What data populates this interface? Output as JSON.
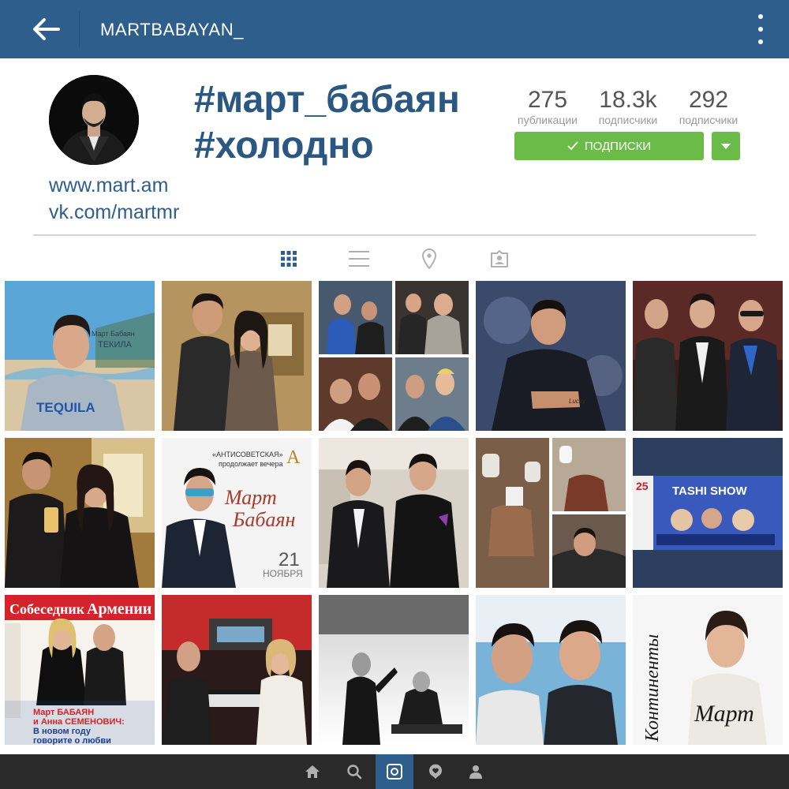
{
  "header": {
    "title": "MARTBABAYAN_",
    "back_icon": "arrow-left-icon",
    "menu_icon": "more-vertical-icon"
  },
  "profile": {
    "hashtags": [
      "#март_бабаян",
      "#холодно"
    ],
    "links": [
      "www.mart.am",
      "vk.com/martmr"
    ],
    "stats": [
      {
        "value": "275",
        "label": "публикации"
      },
      {
        "value": "18.3k",
        "label": "подписчики"
      },
      {
        "value": "292",
        "label": "подписчики"
      }
    ],
    "follow_button": "ПОДПИСКИ",
    "accent_color": "#2e5e8c",
    "follow_color": "#6bbb48"
  },
  "tabs": [
    {
      "name": "grid",
      "icon": "grid-icon",
      "active": true
    },
    {
      "name": "list",
      "icon": "list-icon",
      "active": false
    },
    {
      "name": "map",
      "icon": "location-pin-icon",
      "active": false
    },
    {
      "name": "tagged",
      "icon": "tagged-person-icon",
      "active": false
    }
  ],
  "photos": [
    {
      "id": 1,
      "texts": [
        "Март Бабаян",
        "ТЕКИЛА",
        "TEQUILA"
      ]
    },
    {
      "id": 2,
      "texts": []
    },
    {
      "id": 3,
      "texts": []
    },
    {
      "id": 4,
      "texts": [
        "Lucky"
      ]
    },
    {
      "id": 5,
      "texts": []
    },
    {
      "id": 6,
      "texts": []
    },
    {
      "id": 7,
      "texts": [
        "«АНТИСОВЕТСКАЯ»",
        "продолжает вечера",
        "Март",
        "Бабаян",
        "21",
        "НОЯБРЯ"
      ]
    },
    {
      "id": 8,
      "texts": []
    },
    {
      "id": 9,
      "texts": []
    },
    {
      "id": 10,
      "texts": [
        "25",
        "TASHI SHOW"
      ]
    },
    {
      "id": 11,
      "texts": [
        "Собеседник",
        "Армении",
        "Март БАБАЯН",
        "и Анна СЕМЕНОВИЧ:",
        "В новом году",
        "говорите о любви"
      ]
    },
    {
      "id": 12,
      "texts": []
    },
    {
      "id": 13,
      "texts": []
    },
    {
      "id": 14,
      "texts": []
    },
    {
      "id": 15,
      "texts": [
        "Континенты",
        "Март"
      ]
    }
  ],
  "bottom_nav": [
    {
      "name": "home",
      "icon": "home-icon",
      "active": false
    },
    {
      "name": "search",
      "icon": "search-icon",
      "active": false
    },
    {
      "name": "camera",
      "icon": "camera-icon",
      "active": true
    },
    {
      "name": "activity",
      "icon": "heart-bubble-icon",
      "active": false
    },
    {
      "name": "profile",
      "icon": "person-icon",
      "active": false
    }
  ]
}
